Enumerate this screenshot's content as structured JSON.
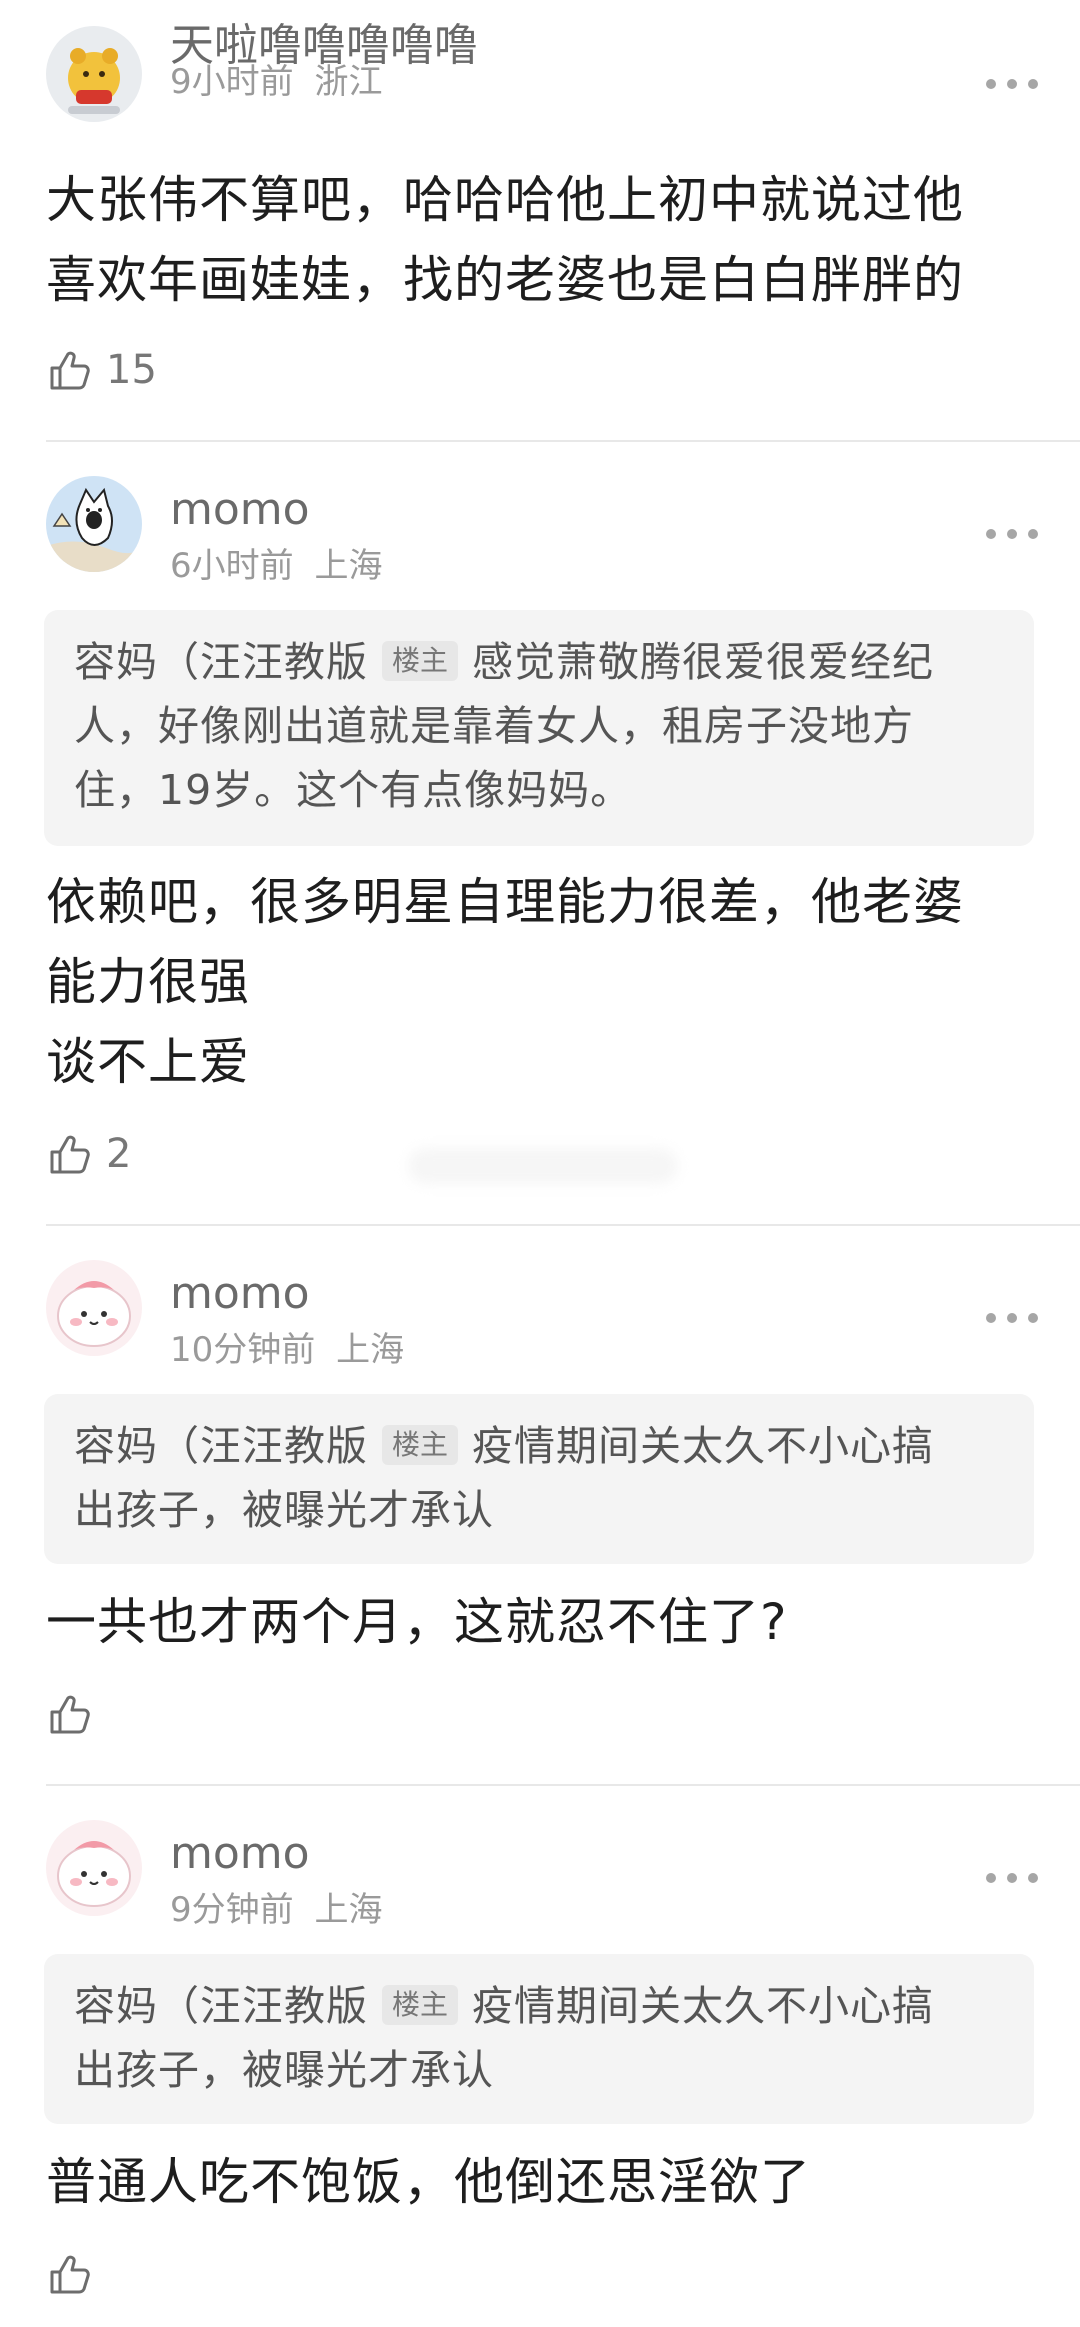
{
  "comments": [
    {
      "username": "天啦噜噜噜噜噜",
      "time": "9小时前",
      "location": "浙江",
      "avatar_icon": "yellow-bear-avatar",
      "quote": null,
      "body_lines": [
        "大张伟不算吧，哈哈哈他上初中就说过他",
        "喜欢年画娃娃，找的老婆也是白白胖胖的"
      ],
      "likes": "15"
    },
    {
      "username": "momo",
      "time": "6小时前",
      "location": "上海",
      "avatar_icon": "cartoon-cat-avatar",
      "quote": {
        "author": "容妈（汪汪教版",
        "badge": "楼主",
        "text_first": "感觉萧敬腾很爱很爱经纪",
        "text_rest": [
          "人，好像刚出道就是靠着女人，租房子没地方",
          "住，19岁。这个有点像妈妈。"
        ]
      },
      "body_lines": [
        "依赖吧，很多明星自理能力很差，他老婆",
        "能力很强",
        "谈不上爱"
      ],
      "likes": "2"
    },
    {
      "username": "momo",
      "time": "10分钟前",
      "location": "上海",
      "avatar_icon": "pink-blob-avatar",
      "quote": {
        "author": "容妈（汪汪教版",
        "badge": "楼主",
        "text_first": "疫情期间关太久不小心搞",
        "text_rest": [
          "出孩子，被曝光才承认"
        ]
      },
      "body_lines": [
        "一共也才两个月，这就忍不住了?"
      ],
      "likes": ""
    },
    {
      "username": "momo",
      "time": "9分钟前",
      "location": "上海",
      "avatar_icon": "pink-blob-avatar",
      "quote": {
        "author": "容妈（汪汪教版",
        "badge": "楼主",
        "text_first": "疫情期间关太久不小心搞",
        "text_rest": [
          "出孩子，被曝光才承认"
        ]
      },
      "body_lines": [
        "普通人吃不饱饭，他倒还思淫欲了"
      ],
      "likes": ""
    }
  ],
  "icons": {
    "like": "thumbs-up-icon",
    "more": "more-options-icon"
  },
  "colors": {
    "username": "#6a6a6a",
    "meta": "#9a9a9a",
    "quote_bg": "#f4f4f4",
    "badge_bg": "#e7e7e7"
  }
}
